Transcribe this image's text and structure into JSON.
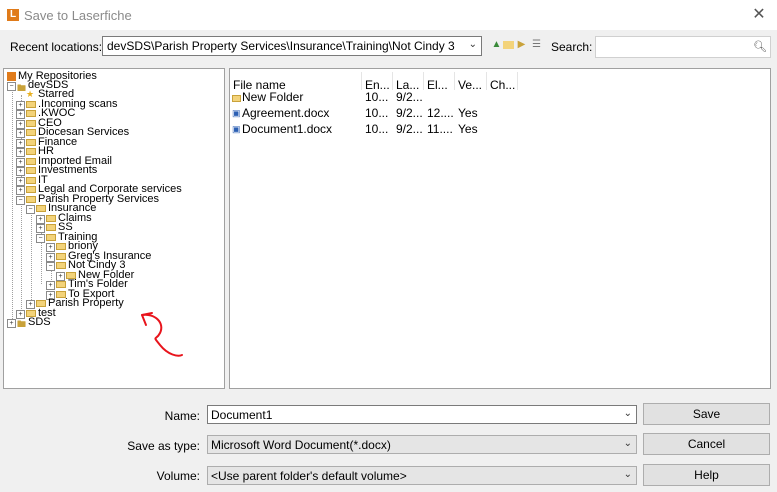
{
  "window": {
    "title": "Save to Laserfiche",
    "app_icon_letter": "L"
  },
  "toolbar": {
    "recent_label": "Recent locations:",
    "recent_value": "devSDS\\Parish Property Services\\Insurance\\Training\\Not Cindy 3",
    "search_label": "Search:",
    "search_value": "",
    "icons": [
      "up-folder-icon",
      "new-folder-icon",
      "bookmark-icon",
      "view-options-icon"
    ]
  },
  "tree": {
    "nodes": [
      {
        "label": "My Repositories"
      },
      {
        "label": "devSDS"
      },
      {
        "label": "Starred"
      },
      {
        "label": ".Incoming scans"
      },
      {
        "label": ".KWOC"
      },
      {
        "label": "CEO"
      },
      {
        "label": "Diocesan Services"
      },
      {
        "label": "Finance"
      },
      {
        "label": "HR"
      },
      {
        "label": "Imported Email"
      },
      {
        "label": "Investments"
      },
      {
        "label": "IT"
      },
      {
        "label": "Legal and Corporate services"
      },
      {
        "label": "Parish Property Services"
      },
      {
        "label": "Insurance"
      },
      {
        "label": "Claims"
      },
      {
        "label": "SS"
      },
      {
        "label": "Training"
      },
      {
        "label": "briony"
      },
      {
        "label": "Greg's Insurance"
      },
      {
        "label": "Not Cindy 3"
      },
      {
        "label": "New Folder"
      },
      {
        "label": "Tim's Folder"
      },
      {
        "label": "To Export"
      },
      {
        "label": "Parish Property"
      },
      {
        "label": "test"
      },
      {
        "label": "SDS"
      }
    ]
  },
  "list": {
    "columns": [
      "File name",
      "En...",
      "La...",
      "El...",
      "Ve...",
      "Ch..."
    ],
    "rows": [
      {
        "name": "New Folder",
        "en": "10...",
        "la": "9/2...",
        "el": "",
        "ve": ""
      },
      {
        "name": "Agreement.docx",
        "en": "10...",
        "la": "9/2...",
        "el": "12....",
        "ve": "Yes"
      },
      {
        "name": "Document1.docx",
        "en": "10...",
        "la": "9/2...",
        "el": "11....",
        "ve": "Yes"
      }
    ]
  },
  "form": {
    "name_label": "Name:",
    "name_value": "Document1",
    "type_label": "Save as type:",
    "type_value": "Microsoft Word Document(*.docx)",
    "volume_label": "Volume:",
    "volume_value": "<Use parent folder's default volume>",
    "save_label": "Save",
    "cancel_label": "Cancel",
    "help_label": "Help"
  },
  "colors": {
    "annotation": "#e8141c",
    "folder": "#f3d37a",
    "accent": "#e07b1a"
  }
}
